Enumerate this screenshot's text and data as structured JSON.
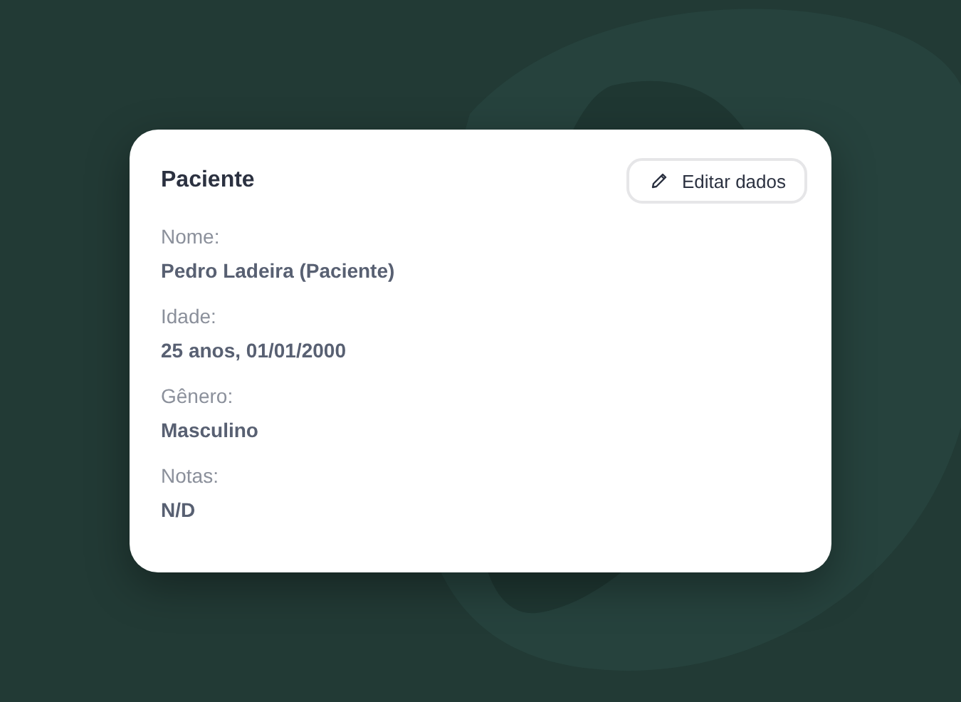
{
  "card": {
    "title": "Paciente",
    "edit_button": {
      "label": "Editar dados"
    },
    "fields": [
      {
        "label": "Nome:",
        "value": "Pedro Ladeira (Paciente)"
      },
      {
        "label": "Idade:",
        "value": "25 anos, 01/01/2000"
      },
      {
        "label": "Gênero:",
        "value": "Masculino"
      },
      {
        "label": "Notas:",
        "value": "N/D"
      }
    ]
  }
}
